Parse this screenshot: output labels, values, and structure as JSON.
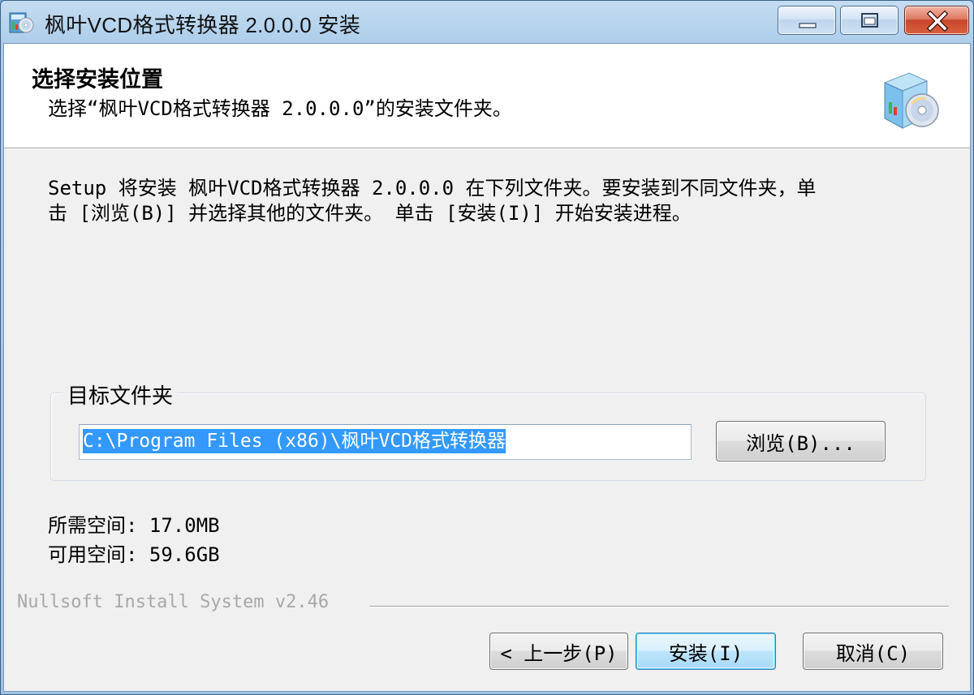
{
  "window": {
    "title": "枫叶VCD格式转换器 2.0.0.0 安装"
  },
  "header": {
    "title": "选择安装位置",
    "subtitle": "选择“枫叶VCD格式转换器 2.0.0.0”的安装文件夹。"
  },
  "body": {
    "intro": "Setup 将安装 枫叶VCD格式转换器 2.0.0.0 在下列文件夹。要安装到不同文件夹，单\n击 [浏览(B)] 并选择其他的文件夹。 单击 [安装(I)] 开始安装进程。"
  },
  "destination": {
    "group_label": "目标文件夹",
    "path": "C:\\Program Files (x86)\\枫叶VCD格式转换器",
    "browse_label": "浏览(B)..."
  },
  "space": {
    "required": "所需空间: 17.0MB",
    "available": "可用空间: 59.6GB"
  },
  "branding": "Nullsoft Install System v2.46",
  "buttons": {
    "back": "< 上一步(P)",
    "install": "安装(I)",
    "cancel": "取消(C)"
  },
  "icons": {
    "app": "installer-cd-icon",
    "header": "install-package-icon"
  }
}
